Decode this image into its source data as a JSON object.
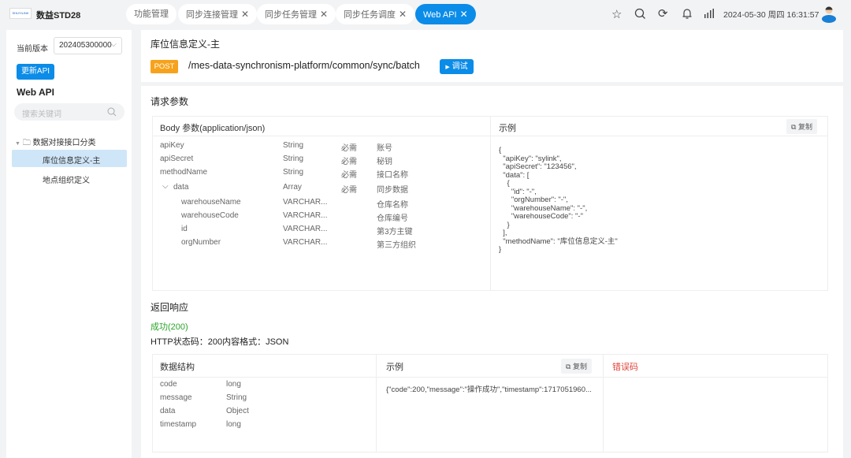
{
  "app": {
    "logo_text": "SHUYILINK",
    "name": "数益STD28"
  },
  "tabs": [
    {
      "label": "功能管理",
      "closable": false
    },
    {
      "label": "同步连接管理",
      "closable": true
    },
    {
      "label": "同步任务管理",
      "closable": true
    },
    {
      "label": "同步任务调度",
      "closable": true
    },
    {
      "label": "Web API",
      "closable": true,
      "active": true
    }
  ],
  "close_glyph": "✕",
  "header": {
    "datetime": "2024-05-30 周四 16:31:57"
  },
  "sidebar": {
    "version_label": "当前版本",
    "version_value": "202405300000",
    "update_button": "更新API",
    "section_title": "Web API",
    "search_placeholder": "搜索关键词",
    "category": "数据对接接口分类",
    "items": [
      "库位信息定义-主",
      "地点组织定义"
    ]
  },
  "main": {
    "title": "库位信息定义-主",
    "method": "POST",
    "path": "/mes-data-synchronism-platform/common/sync/batch",
    "debug_button": "调试",
    "request": {
      "title": "请求参数",
      "body_title": "Body 参数(application/json)",
      "example_title": "示例",
      "copy_label": "复制",
      "params": [
        {
          "name": "apiKey",
          "type": "String",
          "required": "必需",
          "desc": "账号"
        },
        {
          "name": "apiSecret",
          "type": "String",
          "required": "必需",
          "desc": "秘钥"
        },
        {
          "name": "methodName",
          "type": "String",
          "required": "必需",
          "desc": "接口名称"
        },
        {
          "name": "data",
          "type": "Array",
          "required": "必需",
          "desc": "同步数据"
        },
        {
          "name": "warehouseName",
          "type": "VARCHAR...",
          "required": "",
          "desc": "仓库名称"
        },
        {
          "name": "warehouseCode",
          "type": "VARCHAR...",
          "required": "",
          "desc": "仓库编号"
        },
        {
          "name": "id",
          "type": "VARCHAR...",
          "required": "",
          "desc": "第3方主键"
        },
        {
          "name": "orgNumber",
          "type": "VARCHAR...",
          "required": "",
          "desc": "第三方组织"
        }
      ],
      "example": "{\n  \"apiKey\": \"sylink\",\n  \"apiSecret\": \"123456\",\n  \"data\": [\n    {\n      \"id\": \"-\",\n      \"orgNumber\": \"-\",\n      \"warehouseName\": \"-\",\n      \"warehouseCode\": \"-\"\n    }\n  ],\n  \"methodName\": \"库位信息定义-主\"\n}"
    },
    "response": {
      "title": "返回响应",
      "status": "成功(200)",
      "format": "HTTP状态码：200内容格式：JSON",
      "struct_title": "数据结构",
      "example_title": "示例",
      "copy_label": "复制",
      "error_title": "错误码",
      "fields": [
        {
          "name": "code",
          "type": "long"
        },
        {
          "name": "message",
          "type": "String"
        },
        {
          "name": "data",
          "type": "Object"
        },
        {
          "name": "timestamp",
          "type": "long"
        }
      ],
      "example": "{\"code\":200,\"message\":\"操作成功\",\"timestamp\":1717051960..."
    }
  },
  "colors": {
    "accent": "#0b8ce8",
    "post": "#f7a21b",
    "success": "#2aa52a",
    "error": "#e0463c"
  }
}
